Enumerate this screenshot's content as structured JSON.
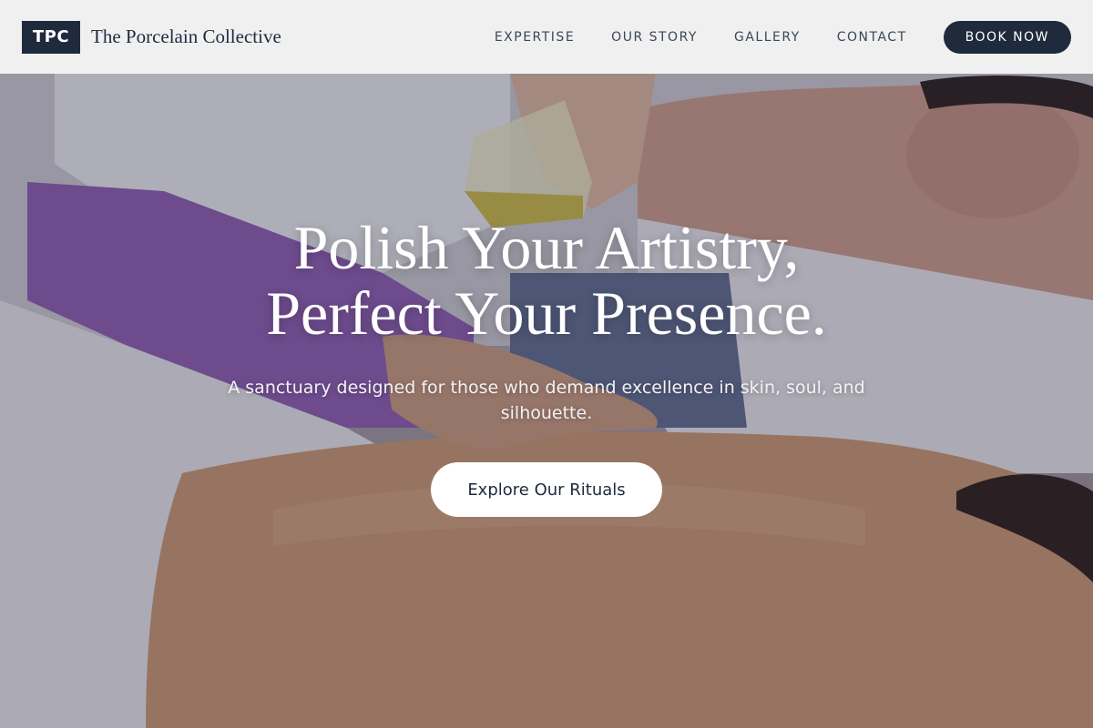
{
  "header": {
    "logo_mark": "TPC",
    "brand_name": "The Porcelain Collective",
    "nav": [
      {
        "label": "EXPERTISE"
      },
      {
        "label": "OUR STORY"
      },
      {
        "label": "GALLERY"
      },
      {
        "label": "CONTACT"
      }
    ],
    "book_label": "BOOK NOW"
  },
  "hero": {
    "headline_line1": "Polish Your Artistry,",
    "headline_line2": "Perfect Your Presence.",
    "subtitle": "A sanctuary designed for those who demand excellence in skin, soul, and silhouette.",
    "cta_label": "Explore Our Rituals",
    "background_image": "massage-oil-pouring-photo"
  },
  "colors": {
    "navy": "#1f2a3c",
    "nav_text": "#3b4656",
    "header_bg": "#f5f5f5",
    "cta_bg": "#ffffff"
  }
}
